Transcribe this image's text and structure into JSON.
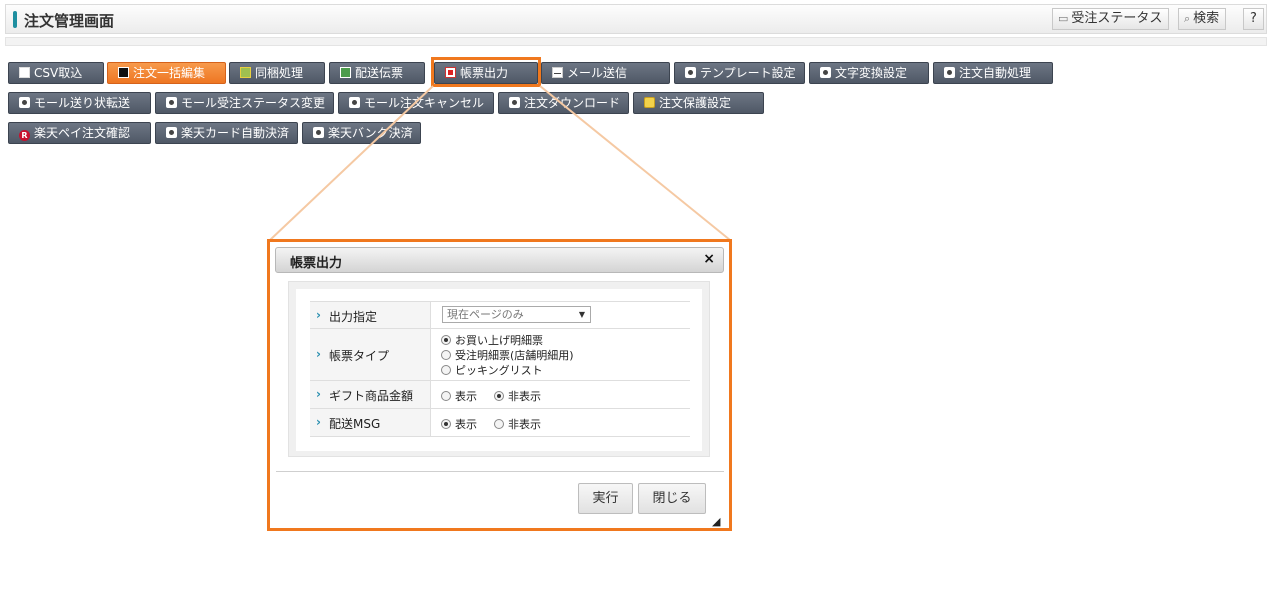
{
  "header": {
    "title": "注文管理画面",
    "status_button": "受注ステータス",
    "search_button": "検索",
    "help_button": "?"
  },
  "toolbar": {
    "row1": [
      {
        "label": "CSV取込",
        "icon": "import-icon",
        "active": false
      },
      {
        "label": "注文一括編集",
        "icon": "edit-icon",
        "active": true
      },
      {
        "label": "同梱処理",
        "icon": "package-icon",
        "active": false
      },
      {
        "label": "配送伝票",
        "icon": "truck-icon",
        "active": false
      },
      {
        "label": "帳票出力",
        "icon": "pdf-icon",
        "active": false
      },
      {
        "label": "メール送信",
        "icon": "mail-icon",
        "active": false
      },
      {
        "label": "テンプレート設定",
        "icon": "gear-icon",
        "active": false
      },
      {
        "label": "文字変換設定",
        "icon": "gear-icon",
        "active": false
      },
      {
        "label": "注文自動処理",
        "icon": "gear-icon",
        "active": false
      }
    ],
    "row2": [
      {
        "label": "モール送り状転送",
        "icon": "gear-icon"
      },
      {
        "label": "モール受注ステータス変更",
        "icon": "gear-icon"
      },
      {
        "label": "モール注文キャンセル",
        "icon": "gear-icon"
      },
      {
        "label": "注文ダウンロード",
        "icon": "gear-icon"
      },
      {
        "label": "注文保護設定",
        "icon": "lock-icon"
      }
    ],
    "row3": [
      {
        "label": "楽天ペイ注文確認",
        "icon": "rakuten-icon",
        "icon_text": "R"
      },
      {
        "label": "楽天カード自動決済",
        "icon": "gear-icon"
      },
      {
        "label": "楽天バンク決済",
        "icon": "gear-icon"
      }
    ]
  },
  "dialog": {
    "title": "帳票出力",
    "close_icon": "×",
    "rows": {
      "output": {
        "label": "出力指定",
        "selected": "現在ページのみ"
      },
      "form_type": {
        "label": "帳票タイプ",
        "options": [
          "お買い上げ明細票",
          "受注明細票(店舗明細用)",
          "ピッキングリスト"
        ],
        "selected_index": 0
      },
      "gift_amount": {
        "label": "ギフト商品金額",
        "options": [
          "表示",
          "非表示"
        ],
        "selected_index": 1
      },
      "delivery_msg": {
        "label": "配送MSG",
        "options": [
          "表示",
          "非表示"
        ],
        "selected_index": 0
      }
    },
    "execute_button": "実行",
    "close_button": "閉じる"
  },
  "colors": {
    "highlight": "#f0781e",
    "button_dark": "#5a6370",
    "button_active": "#f0781e",
    "accent": "#1f8fa0"
  }
}
